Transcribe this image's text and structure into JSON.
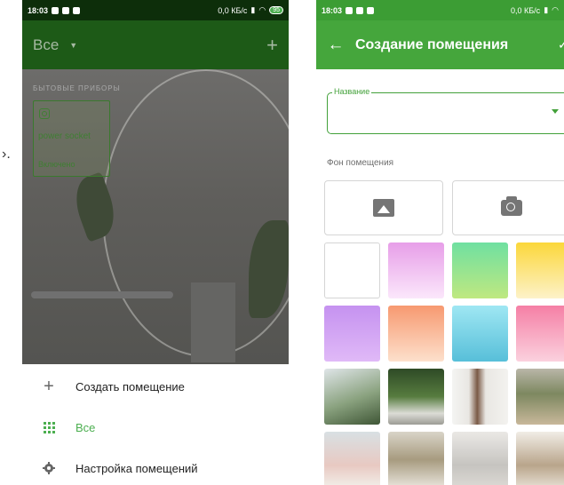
{
  "left_screen": {
    "status": {
      "time": "18:03",
      "speed": "0,0 КБ/с",
      "battery": "95"
    },
    "header": {
      "title": "Все"
    },
    "section_label": "БЫТОВЫЕ ПРИБОРЫ",
    "device": {
      "name": "power socket",
      "status": "Включено"
    },
    "sheet": {
      "items": [
        {
          "label": "Создать помещение",
          "icon": "plus-icon"
        },
        {
          "label": "Все",
          "icon": "grid-icon",
          "color": "#4caf50"
        },
        {
          "label": "Настройка помещений",
          "icon": "gear-icon"
        }
      ]
    }
  },
  "right_screen": {
    "status": {
      "time": "18:03",
      "speed": "0,0 КБ/с"
    },
    "header": {
      "title": "Создание помещения"
    },
    "name_field": {
      "label": "Название",
      "value": ""
    },
    "background_label": "Фон помещения",
    "background_pickers": [
      {
        "icon": "image-icon"
      },
      {
        "icon": "camera-icon"
      }
    ],
    "colors": {
      "accent": "#45a63c",
      "dark_header": "#1d5a17"
    }
  }
}
